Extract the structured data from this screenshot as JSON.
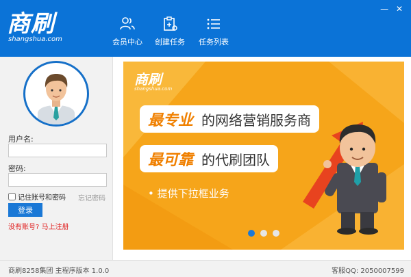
{
  "header": {
    "logo_main": "商刷",
    "logo_sub": "shangshua.com",
    "nav": [
      {
        "label": "会员中心",
        "icon": "user-group-icon"
      },
      {
        "label": "创建任务",
        "icon": "clipboard-add-icon"
      },
      {
        "label": "任务列表",
        "icon": "list-icon"
      }
    ],
    "window": {
      "minimize": "—",
      "close": "✕"
    }
  },
  "login": {
    "username_label": "用户名:",
    "username_value": "",
    "password_label": "密码:",
    "password_value": "",
    "remember_label": "记住账号和密码",
    "remember_checked": false,
    "forgot_label": "忘记密码",
    "login_button": "登录",
    "register_link": "没有账号? 马上注册"
  },
  "banner": {
    "logo_main": "商刷",
    "logo_sub": "shangshua.com",
    "line1_highlight": "最专业",
    "line1_rest": "的网络营销服务商",
    "line2_highlight": "最可靠",
    "line2_rest": "的代刷团队",
    "bullet": "• 提供下拉框业务",
    "slides": 3,
    "active_slide": 0
  },
  "footer": {
    "left": "商刷8258集团 主程序版本 1.0.0",
    "right": "客服QQ: 2050007599"
  },
  "colors": {
    "header_blue": "#0b73d7",
    "banner_orange": "#f6a51a",
    "highlight_orange": "#f08000",
    "register_red": "#e02020"
  }
}
